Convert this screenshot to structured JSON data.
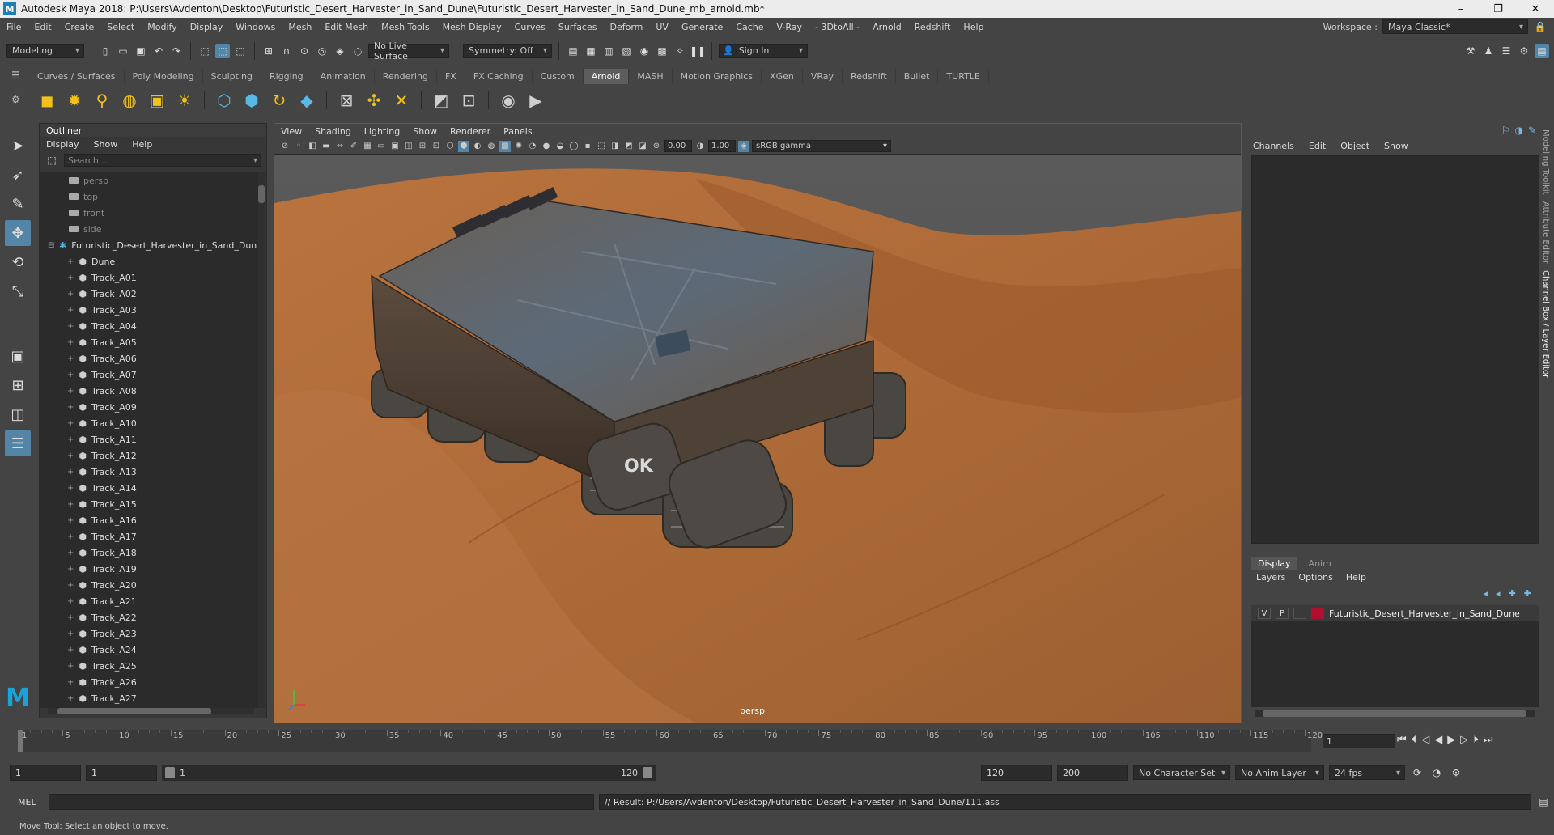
{
  "window": {
    "title": "Autodesk Maya 2018: P:\\Users\\Avdenton\\Desktop\\Futuristic_Desert_Harvester_in_Sand_Dune\\Futuristic_Desert_Harvester_in_Sand_Dune_mb_arnold.mb*",
    "minimize": "–",
    "maximize": "❐",
    "close": "✕"
  },
  "menubar": {
    "items": [
      "File",
      "Edit",
      "Create",
      "Select",
      "Modify",
      "Display",
      "Windows",
      "Mesh",
      "Edit Mesh",
      "Mesh Tools",
      "Mesh Display",
      "Curves",
      "Surfaces",
      "Deform",
      "UV",
      "Generate",
      "Cache",
      "V-Ray",
      "- 3DtoAll -",
      "Arnold",
      "Redshift",
      "Help"
    ],
    "workspace_label": "Workspace :",
    "workspace_value": "Maya Classic*"
  },
  "statusline": {
    "mode": "Modeling",
    "live_surface": "No Live Surface",
    "symmetry": "Symmetry: Off",
    "sign_in": "Sign In"
  },
  "shelf": {
    "tabs": [
      "Curves / Surfaces",
      "Poly Modeling",
      "Sculpting",
      "Rigging",
      "Animation",
      "Rendering",
      "FX",
      "FX Caching",
      "Custom",
      "Arnold",
      "MASH",
      "Motion Graphics",
      "XGen",
      "VRay",
      "Redshift",
      "Bullet",
      "TURTLE"
    ],
    "active_tab": "Arnold"
  },
  "outliner": {
    "title": "Outliner",
    "menu": [
      "Display",
      "Show",
      "Help"
    ],
    "search_placeholder": "Search...",
    "cameras": [
      "persp",
      "top",
      "front",
      "side"
    ],
    "group": "Futuristic_Desert_Harvester_in_Sand_Dun",
    "children": [
      "Dune",
      "Track_A01",
      "Track_A02",
      "Track_A03",
      "Track_A04",
      "Track_A05",
      "Track_A06",
      "Track_A07",
      "Track_A08",
      "Track_A09",
      "Track_A10",
      "Track_A11",
      "Track_A12",
      "Track_A13",
      "Track_A14",
      "Track_A15",
      "Track_A16",
      "Track_A17",
      "Track_A18",
      "Track_A19",
      "Track_A20",
      "Track_A21",
      "Track_A22",
      "Track_A23",
      "Track_A24",
      "Track_A25",
      "Track_A26",
      "Track_A27"
    ]
  },
  "viewport": {
    "menu": [
      "View",
      "Shading",
      "Lighting",
      "Show",
      "Renderer",
      "Panels"
    ],
    "exposure": "0.00",
    "gamma": "1.00",
    "color_space": "sRGB gamma",
    "camera_label": "persp",
    "harvester_decal": "OK"
  },
  "channelbox": {
    "menu": [
      "Channels",
      "Edit",
      "Object",
      "Show"
    ]
  },
  "layereditor": {
    "tabs": [
      "Display",
      "Anim"
    ],
    "active_tab": "Display",
    "menu": [
      "Layers",
      "Options",
      "Help"
    ],
    "layer": {
      "v": "V",
      "p": "P",
      "name": "Futuristic_Desert_Harvester_in_Sand_Dune",
      "color": "#b01030"
    }
  },
  "sidetabs": [
    "Modeling Toolkit",
    "Attribute Editor",
    "Channel Box / Layer Editor"
  ],
  "timeline": {
    "labels": [
      "1",
      "5",
      "10",
      "15",
      "20",
      "25",
      "30",
      "35",
      "40",
      "45",
      "50",
      "55",
      "60",
      "65",
      "70",
      "75",
      "80",
      "85",
      "90",
      "95",
      "100",
      "105",
      "110",
      "115",
      "120"
    ],
    "current_frame": "1"
  },
  "range": {
    "start": "1",
    "playback_start": "1",
    "slider_start": "1",
    "slider_end": "120",
    "playback_end": "120",
    "end": "200",
    "character_set": "No Character Set",
    "anim_layer": "No Anim Layer",
    "fps": "24 fps"
  },
  "cmdline": {
    "label": "MEL",
    "result": "// Result: P:/Users/Avdenton/Desktop/Futuristic_Desert_Harvester_in_Sand_Dune/111.ass"
  },
  "helpline": {
    "text": "Move Tool: Select an object to move."
  }
}
